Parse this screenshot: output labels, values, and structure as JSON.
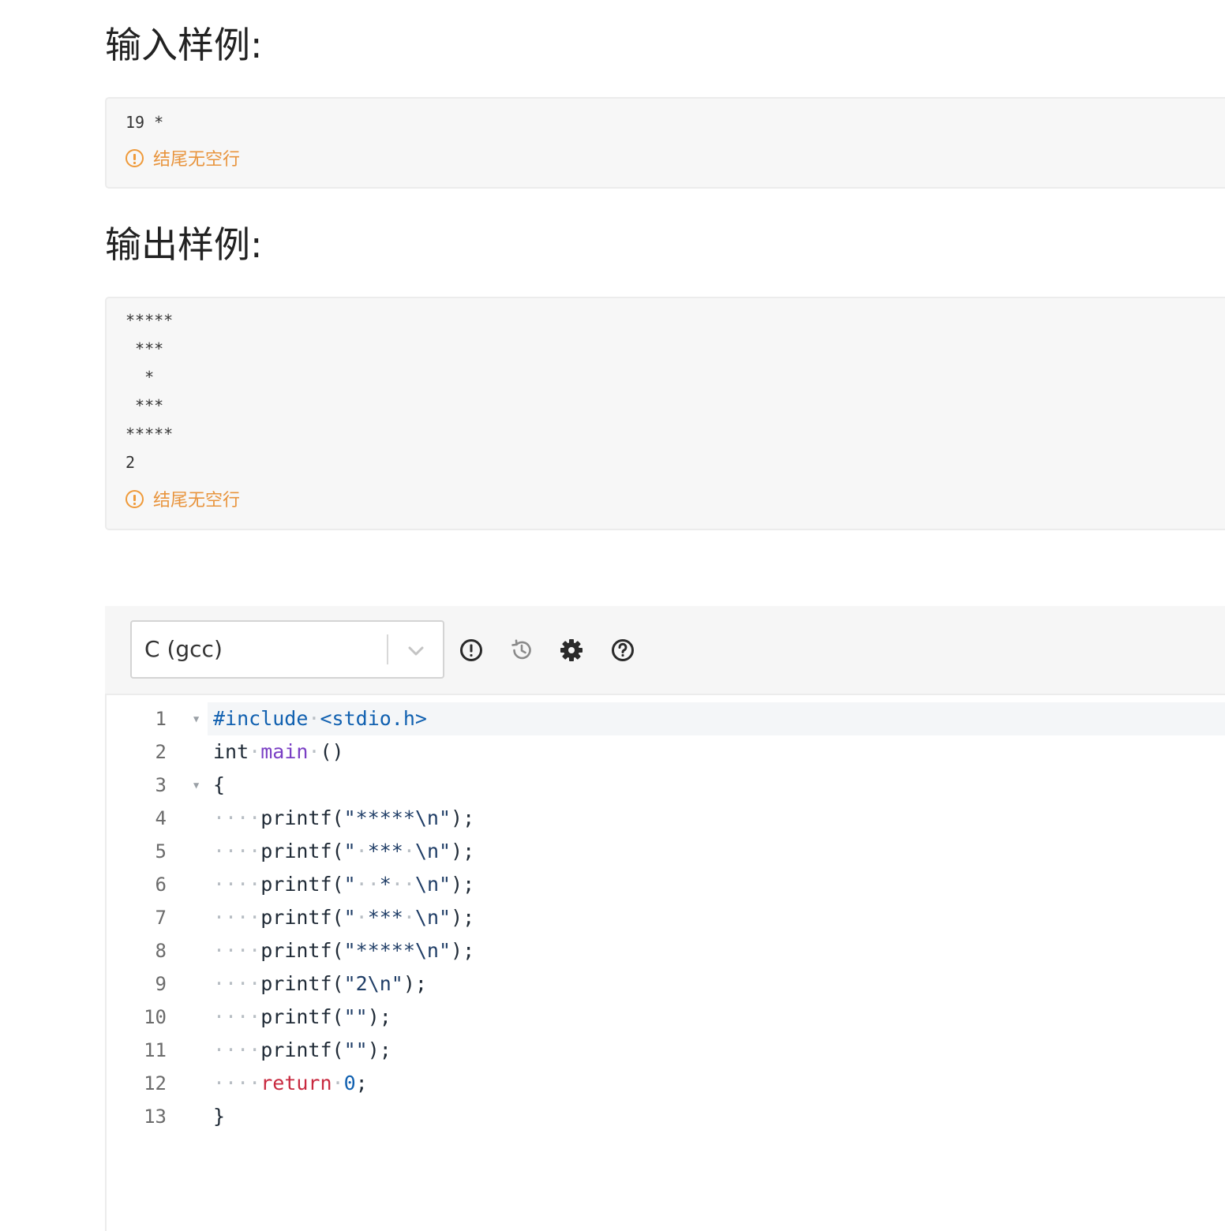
{
  "input_sample": {
    "heading": "输入样例:",
    "text": "19 *",
    "notice": "结尾无空行"
  },
  "output_sample": {
    "heading": "输出样例:",
    "text": "*****\n ***\n  *\n ***\n*****\n2",
    "notice": "结尾无空行"
  },
  "editor": {
    "language": "C (gcc)",
    "toolbar_icons": [
      "info-icon",
      "history-icon",
      "settings-icon",
      "help-icon"
    ],
    "lines": [
      {
        "no": "1",
        "fold": true,
        "tokens": [
          [
            "dir",
            "#include"
          ],
          [
            "ws",
            "·"
          ],
          [
            "dir",
            "<stdio.h>"
          ]
        ]
      },
      {
        "no": "2",
        "fold": false,
        "tokens": [
          [
            "plain",
            "int"
          ],
          [
            "ws",
            "·"
          ],
          [
            "fn",
            "main"
          ],
          [
            "ws",
            "·"
          ],
          [
            "plain",
            "()"
          ]
        ]
      },
      {
        "no": "3",
        "fold": true,
        "tokens": [
          [
            "plain",
            "{"
          ]
        ]
      },
      {
        "no": "4",
        "fold": false,
        "tokens": [
          [
            "ws",
            "····"
          ],
          [
            "plain",
            "printf("
          ],
          [
            "str",
            "\"*****\\n\""
          ],
          [
            "plain",
            ");"
          ]
        ]
      },
      {
        "no": "5",
        "fold": false,
        "tokens": [
          [
            "ws",
            "····"
          ],
          [
            "plain",
            "printf("
          ],
          [
            "str",
            "\""
          ],
          [
            "ws",
            "·"
          ],
          [
            "str",
            "***"
          ],
          [
            "ws",
            "·"
          ],
          [
            "str",
            "\\n\""
          ],
          [
            "plain",
            ");"
          ]
        ]
      },
      {
        "no": "6",
        "fold": false,
        "tokens": [
          [
            "ws",
            "····"
          ],
          [
            "plain",
            "printf("
          ],
          [
            "str",
            "\""
          ],
          [
            "ws",
            "··"
          ],
          [
            "str",
            "*"
          ],
          [
            "ws",
            "··"
          ],
          [
            "str",
            "\\n\""
          ],
          [
            "plain",
            ");"
          ]
        ]
      },
      {
        "no": "7",
        "fold": false,
        "tokens": [
          [
            "ws",
            "····"
          ],
          [
            "plain",
            "printf("
          ],
          [
            "str",
            "\""
          ],
          [
            "ws",
            "·"
          ],
          [
            "str",
            "***"
          ],
          [
            "ws",
            "·"
          ],
          [
            "str",
            "\\n\""
          ],
          [
            "plain",
            ");"
          ]
        ]
      },
      {
        "no": "8",
        "fold": false,
        "tokens": [
          [
            "ws",
            "····"
          ],
          [
            "plain",
            "printf("
          ],
          [
            "str",
            "\"*****\\n\""
          ],
          [
            "plain",
            ");"
          ]
        ]
      },
      {
        "no": "9",
        "fold": false,
        "tokens": [
          [
            "ws",
            "····"
          ],
          [
            "plain",
            "printf("
          ],
          [
            "str",
            "\"2\\n\""
          ],
          [
            "plain",
            ");"
          ]
        ]
      },
      {
        "no": "10",
        "fold": false,
        "tokens": [
          [
            "ws",
            "····"
          ],
          [
            "plain",
            "printf("
          ],
          [
            "str",
            "\"\""
          ],
          [
            "plain",
            ");"
          ]
        ]
      },
      {
        "no": "11",
        "fold": false,
        "tokens": [
          [
            "ws",
            "····"
          ],
          [
            "plain",
            "printf("
          ],
          [
            "str",
            "\"\""
          ],
          [
            "plain",
            ");"
          ]
        ]
      },
      {
        "no": "12",
        "fold": false,
        "tokens": [
          [
            "ws",
            "····"
          ],
          [
            "kw",
            "return"
          ],
          [
            "ws",
            "·"
          ],
          [
            "num",
            "0"
          ],
          [
            "plain",
            ";"
          ]
        ]
      },
      {
        "no": "13",
        "fold": false,
        "tokens": [
          [
            "plain",
            "}"
          ]
        ]
      }
    ]
  },
  "colors": {
    "notice": "#e8943d",
    "directive": "#1060b0",
    "function": "#7a3fc4",
    "keyword": "#c8293f"
  }
}
